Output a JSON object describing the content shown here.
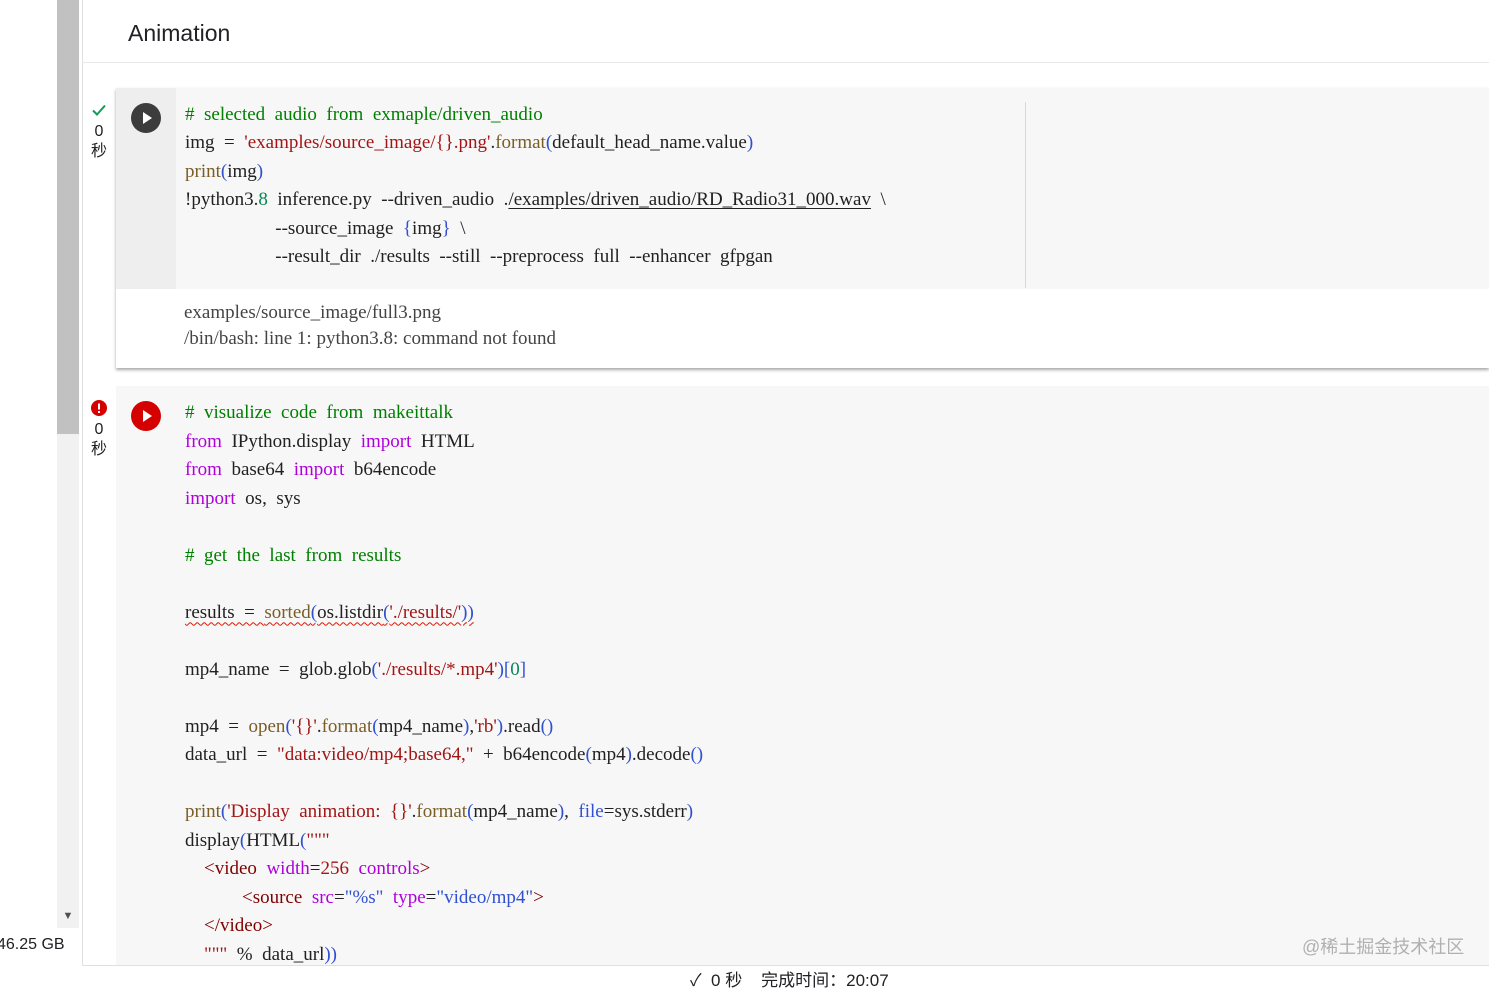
{
  "section": {
    "title": "Animation"
  },
  "sidebar": {
    "disk_usage": "46.25 GB"
  },
  "cell1": {
    "status": {
      "icon": "check-icon",
      "count": "0",
      "unit": "秒"
    },
    "code": [
      [
        [
          "cm",
          "#  selected  audio  from  exmaple/driven_audio"
        ]
      ],
      [
        [
          "op",
          "img  =  "
        ],
        [
          "st",
          "'examples/source_image/{}.png'"
        ],
        [
          "op",
          "."
        ],
        [
          "fn",
          "format"
        ],
        [
          "pa",
          "("
        ],
        [
          "op",
          "default_head_name.value"
        ],
        [
          "pa",
          ")"
        ]
      ],
      [
        [
          "fn",
          "print"
        ],
        [
          "pa",
          "("
        ],
        [
          "op",
          "img"
        ],
        [
          "pa",
          ")"
        ]
      ],
      [
        [
          "op",
          "!python3."
        ],
        [
          "nu",
          "8"
        ],
        [
          "op",
          "  inference.py  --driven_audio  ."
        ],
        [
          "link",
          "/examples/driven_audio/RD_Radio31_000.wav"
        ],
        [
          "op",
          "  \\"
        ]
      ],
      [
        [
          "op",
          "                   --source_image  "
        ],
        [
          "pa",
          "{"
        ],
        [
          "op",
          "img"
        ],
        [
          "pa",
          "}"
        ],
        [
          "op",
          "  \\"
        ]
      ],
      [
        [
          "op",
          "                   --result_dir  ./results  --still  --preprocess  full  --enhancer  gfpgan"
        ]
      ]
    ],
    "output": [
      "examples/source_image/full3.png",
      "/bin/bash: line 1: python3.8: command not found"
    ]
  },
  "cell2": {
    "status": {
      "icon": "error-icon",
      "count": "0",
      "unit": "秒"
    },
    "code": [
      [
        [
          "cm",
          "#  visualize  code  from  makeittalk"
        ]
      ],
      [
        [
          "kw",
          "from"
        ],
        [
          "op",
          "  IPython.display  "
        ],
        [
          "kw",
          "import"
        ],
        [
          "op",
          "  HTML"
        ]
      ],
      [
        [
          "kw",
          "from"
        ],
        [
          "op",
          "  base64  "
        ],
        [
          "kw",
          "import"
        ],
        [
          "op",
          "  b64encode"
        ]
      ],
      [
        [
          "kw",
          "import"
        ],
        [
          "op",
          "  os,  sys"
        ]
      ],
      [],
      [
        [
          "cm",
          "#  get  the  last  from  results"
        ]
      ],
      [],
      [
        [
          "squig",
          [
            [
              "op",
              "results  =  "
            ],
            [
              "fn",
              "sorted"
            ],
            [
              "pa",
              "("
            ],
            [
              "op",
              "os.listdir"
            ],
            [
              "pa",
              "("
            ],
            [
              "st",
              "'./results/'"
            ],
            [
              "pa",
              "))"
            ]
          ]
        ]
      ],
      [],
      [
        [
          "op",
          "mp4_name  =  glob.glob"
        ],
        [
          "pa",
          "("
        ],
        [
          "st",
          "'./results/*.mp4'"
        ],
        [
          "pa",
          ")"
        ],
        [
          "pa",
          "["
        ],
        [
          "nu",
          "0"
        ],
        [
          "pa",
          "]"
        ]
      ],
      [],
      [
        [
          "op",
          "mp4  =  "
        ],
        [
          "fn",
          "open"
        ],
        [
          "pa",
          "("
        ],
        [
          "st",
          "'{}'"
        ],
        [
          "op",
          "."
        ],
        [
          "fn",
          "format"
        ],
        [
          "pa",
          "("
        ],
        [
          "op",
          "mp4_name"
        ],
        [
          "pa",
          ")"
        ],
        [
          "op",
          ","
        ],
        [
          "st",
          "'rb'"
        ],
        [
          "pa",
          ")"
        ],
        [
          "op",
          ".read"
        ],
        [
          "pa",
          "()"
        ]
      ],
      [
        [
          "op",
          "data_url  =  "
        ],
        [
          "st",
          "\"data:video/mp4;base64,\""
        ],
        [
          "op",
          "  +  b64encode"
        ],
        [
          "pa",
          "("
        ],
        [
          "op",
          "mp4"
        ],
        [
          "pa",
          ")"
        ],
        [
          "op",
          ".decode"
        ],
        [
          "pa",
          "()"
        ]
      ],
      [],
      [
        [
          "fn",
          "print"
        ],
        [
          "pa",
          "("
        ],
        [
          "st",
          "'Display  animation:  {}'"
        ],
        [
          "op",
          "."
        ],
        [
          "fn",
          "format"
        ],
        [
          "pa",
          "("
        ],
        [
          "op",
          "mp4_name"
        ],
        [
          "pa",
          ")"
        ],
        [
          "op",
          ",  "
        ],
        [
          "pa",
          "file"
        ],
        [
          "op",
          "=sys.stderr"
        ],
        [
          "pa",
          ")"
        ]
      ],
      [
        [
          "op",
          "display"
        ],
        [
          "pa",
          "("
        ],
        [
          "op",
          "HTML"
        ],
        [
          "pa",
          "("
        ],
        [
          "st",
          "\"\"\""
        ]
      ],
      [
        [
          "op",
          "    "
        ],
        [
          "tg",
          "<video"
        ],
        [
          "op",
          "  "
        ],
        [
          "at",
          "width"
        ],
        [
          "op",
          "="
        ],
        [
          "st",
          "256"
        ],
        [
          "op",
          "  "
        ],
        [
          "at",
          "controls"
        ],
        [
          "tg",
          ">"
        ]
      ],
      [
        [
          "op",
          "            "
        ],
        [
          "tg",
          "<source"
        ],
        [
          "op",
          "  "
        ],
        [
          "at",
          "src"
        ],
        [
          "op",
          "="
        ],
        [
          "pa",
          "\"%s\""
        ],
        [
          "op",
          "  "
        ],
        [
          "at",
          "type"
        ],
        [
          "op",
          "="
        ],
        [
          "pa",
          "\"video/mp4\""
        ],
        [
          "tg",
          ">"
        ]
      ],
      [
        [
          "op",
          "    "
        ],
        [
          "tg",
          "</video>"
        ]
      ],
      [
        [
          "op",
          "    "
        ],
        [
          "st",
          "\"\"\""
        ],
        [
          "op",
          "  %  data_url"
        ],
        [
          "pa",
          "))"
        ]
      ]
    ]
  },
  "footer": {
    "status": "✓  0 秒    完成时间：20:07"
  },
  "watermark": "@稀土掘金技术社区",
  "colors": {
    "comment": "#008000",
    "keyword": "#af00db",
    "string": "#a31515",
    "function": "#795e26",
    "error": "#d50000",
    "success": "#0f9d58"
  }
}
